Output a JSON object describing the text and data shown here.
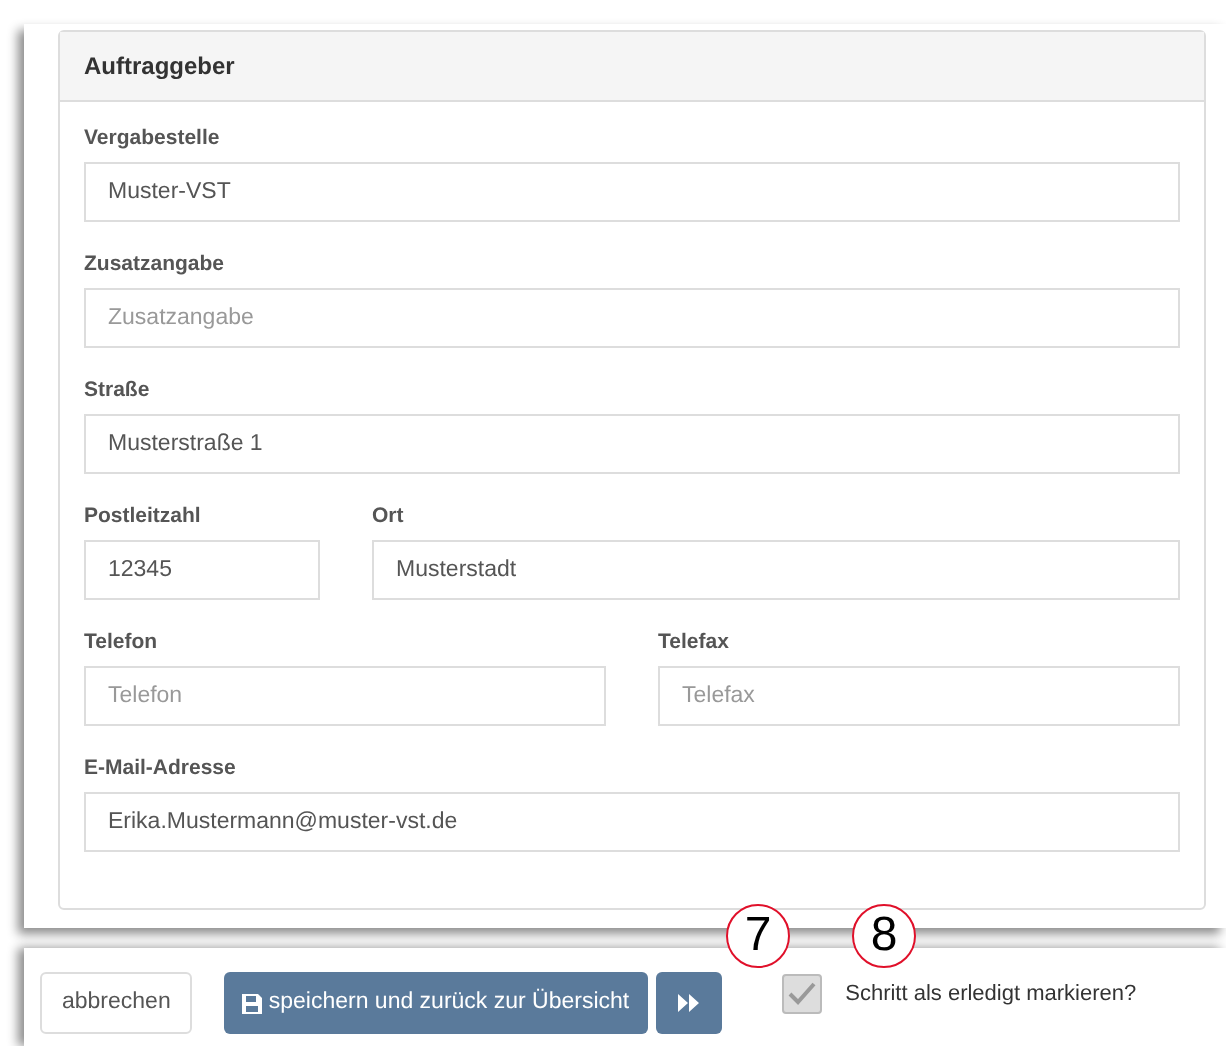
{
  "panel": {
    "title": "Auftraggeber"
  },
  "rows": [
    {
      "fields": [
        {
          "label": "Vergabestelle",
          "value": "Muster-VST"
        }
      ]
    },
    {
      "fields": [
        {
          "label": "Zusatzangabe",
          "placeholder": "Zusatzangabe"
        }
      ]
    },
    {
      "fields": [
        {
          "label": "Straße",
          "value": "Musterstraße 1"
        }
      ]
    },
    {
      "fields": [
        {
          "label": "Postleitzahl",
          "value": "12345"
        },
        {
          "label": "Ort",
          "value": "Musterstadt"
        }
      ]
    },
    {
      "fields": [
        {
          "label": "Telefon",
          "placeholder": "Telefon"
        },
        {
          "label": "Telefax",
          "placeholder": "Telefax"
        }
      ]
    },
    {
      "fields": [
        {
          "label": "E-Mail-Adresse",
          "value": "Erika.Mustermann@muster-vst.de"
        }
      ]
    }
  ],
  "footer": {
    "cancel": "abbrechen",
    "save": "speichern und zurück zur Übersicht",
    "callouts": [
      "7",
      "8"
    ],
    "done": {
      "label": "Schritt als erledigt markieren?",
      "checked": true,
      "disabled": true
    }
  }
}
